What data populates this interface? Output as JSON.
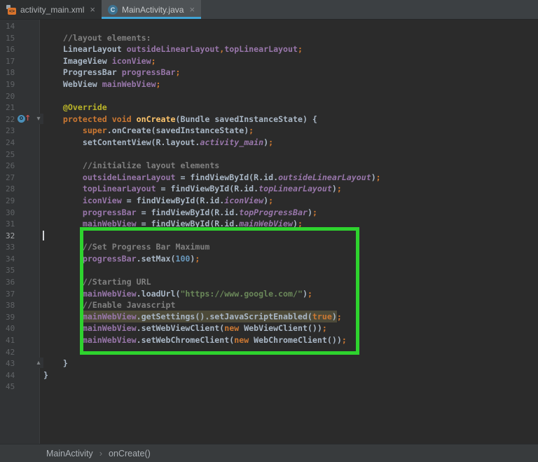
{
  "tabs": [
    {
      "label": "activity_main.xml",
      "icon": "android-layout-xml-icon",
      "active": false
    },
    {
      "label": "MainActivity.java",
      "icon": "java-class-icon",
      "active": true
    }
  ],
  "icons": {
    "close_glyph": "×",
    "xml_icon_glyph": "<>",
    "class_icon_letter": "C",
    "fold_open_glyph": "▾",
    "fold_close_glyph": "▴",
    "override_letter": "o",
    "override_arrow": "↑",
    "breadcrumb_separator": "›"
  },
  "colors": {
    "editor_bg": "#2B2B2B",
    "gutter_bg": "#313335",
    "tab_active_underline": "#40A3D5",
    "annotation_box_green": "#2ED32E",
    "usage_highlight": "#4D4A39",
    "keyword_orange": "#CC7832",
    "field_purple": "#9876AA",
    "string_green": "#6A8759",
    "comment_gray": "#808080"
  },
  "breadcrumb": {
    "items": [
      "MainActivity",
      "onCreate()"
    ]
  },
  "editor": {
    "current_line": 32,
    "lines": [
      {
        "n": 14,
        "t": []
      },
      {
        "n": 15,
        "t": [
          [
            "    ",
            "p"
          ],
          [
            "//layout elements:",
            "c"
          ]
        ]
      },
      {
        "n": 16,
        "t": [
          [
            "    LinearLayout ",
            "p"
          ],
          [
            "outsideLinearLayout",
            "f"
          ],
          [
            ",",
            "k"
          ],
          [
            "topLinearLayout",
            "f"
          ],
          [
            ";",
            "k"
          ]
        ]
      },
      {
        "n": 17,
        "t": [
          [
            "    ImageView ",
            "p"
          ],
          [
            "iconView",
            "f"
          ],
          [
            ";",
            "k"
          ]
        ]
      },
      {
        "n": 18,
        "t": [
          [
            "    ProgressBar ",
            "p"
          ],
          [
            "progressBar",
            "f"
          ],
          [
            ";",
            "k"
          ]
        ]
      },
      {
        "n": 19,
        "t": [
          [
            "    WebView ",
            "p"
          ],
          [
            "mainWebView",
            "f"
          ],
          [
            ";",
            "k"
          ]
        ]
      },
      {
        "n": 20,
        "t": []
      },
      {
        "n": 21,
        "t": [
          [
            "    ",
            "p"
          ],
          [
            "@Override",
            "a"
          ]
        ]
      },
      {
        "n": 22,
        "marker": "override",
        "t": [
          [
            "    ",
            "p"
          ],
          [
            "protected",
            "k"
          ],
          [
            " ",
            "p"
          ],
          [
            "void",
            "k"
          ],
          [
            " ",
            "p"
          ],
          [
            "onCreate",
            "m"
          ],
          [
            "(Bundle savedInstanceState) {",
            "p"
          ]
        ]
      },
      {
        "n": 23,
        "t": [
          [
            "        ",
            "p"
          ],
          [
            "super",
            "k"
          ],
          [
            ".onCreate(savedInstanceState)",
            "p"
          ],
          [
            ";",
            "k"
          ]
        ]
      },
      {
        "n": 24,
        "t": [
          [
            "        setContentView(R.layout.",
            "p"
          ],
          [
            "activity_main",
            "fi"
          ],
          [
            ")",
            "p"
          ],
          [
            ";",
            "k"
          ]
        ]
      },
      {
        "n": 25,
        "t": []
      },
      {
        "n": 26,
        "t": [
          [
            "        ",
            "p"
          ],
          [
            "//initialize layout elements",
            "c"
          ]
        ]
      },
      {
        "n": 27,
        "t": [
          [
            "        ",
            "p"
          ],
          [
            "outsideLinearLayout",
            "f"
          ],
          [
            " = findViewById(R.id.",
            "p"
          ],
          [
            "outsideLinearLayout",
            "fi"
          ],
          [
            ")",
            "p"
          ],
          [
            ";",
            "k"
          ]
        ]
      },
      {
        "n": 28,
        "t": [
          [
            "        ",
            "p"
          ],
          [
            "topLinearLayout",
            "f"
          ],
          [
            " = findViewById(R.id.",
            "p"
          ],
          [
            "topLinearLayout",
            "fi"
          ],
          [
            ")",
            "p"
          ],
          [
            ";",
            "k"
          ]
        ]
      },
      {
        "n": 29,
        "t": [
          [
            "        ",
            "p"
          ],
          [
            "iconView",
            "f"
          ],
          [
            " = findViewById(R.id.",
            "p"
          ],
          [
            "iconView",
            "fi"
          ],
          [
            ")",
            "p"
          ],
          [
            ";",
            "k"
          ]
        ]
      },
      {
        "n": 30,
        "t": [
          [
            "        ",
            "p"
          ],
          [
            "progressBar",
            "f"
          ],
          [
            " = findViewById(R.id.",
            "p"
          ],
          [
            "topProgressBar",
            "fi"
          ],
          [
            ")",
            "p"
          ],
          [
            ";",
            "k"
          ]
        ]
      },
      {
        "n": 31,
        "t": [
          [
            "        ",
            "p"
          ],
          [
            "mainWebView",
            "f"
          ],
          [
            " = findViewById(R.id.",
            "p"
          ],
          [
            "mainWebView",
            "fi"
          ],
          [
            ")",
            "p"
          ],
          [
            ";",
            "k"
          ]
        ]
      },
      {
        "n": 32,
        "caret": true,
        "t": []
      },
      {
        "n": 33,
        "t": [
          [
            "        ",
            "p"
          ],
          [
            "//Set Progress Bar Maximum",
            "c"
          ]
        ]
      },
      {
        "n": 34,
        "t": [
          [
            "        ",
            "p"
          ],
          [
            "progressBar",
            "f"
          ],
          [
            ".setMax(",
            "p"
          ],
          [
            "100",
            "n"
          ],
          [
            ")",
            "p"
          ],
          [
            ";",
            "k"
          ]
        ]
      },
      {
        "n": 35,
        "t": []
      },
      {
        "n": 36,
        "t": [
          [
            "        ",
            "p"
          ],
          [
            "//Starting URL",
            "c"
          ]
        ]
      },
      {
        "n": 37,
        "t": [
          [
            "        ",
            "p"
          ],
          [
            "mainWebView",
            "f"
          ],
          [
            ".loadUrl(",
            "p"
          ],
          [
            "\"https://www.google.com/\"",
            "s"
          ],
          [
            ")",
            "p"
          ],
          [
            ";",
            "k"
          ]
        ]
      },
      {
        "n": 38,
        "t": [
          [
            "        ",
            "p"
          ],
          [
            "//Enable Javascript",
            "c"
          ]
        ]
      },
      {
        "n": 39,
        "t": [
          [
            "        ",
            "p"
          ],
          [
            "mainWebView",
            "f",
            1
          ],
          [
            ".getSettings().setJavaScriptEnabled(",
            "p",
            1
          ],
          [
            "true",
            "k",
            1
          ],
          [
            ")",
            "p",
            1
          ],
          [
            ";",
            "k"
          ]
        ]
      },
      {
        "n": 40,
        "t": [
          [
            "        ",
            "p"
          ],
          [
            "mainWebView",
            "f"
          ],
          [
            ".setWebViewClient(",
            "p"
          ],
          [
            "new",
            "k"
          ],
          [
            " WebViewClient())",
            "p"
          ],
          [
            ";",
            "k"
          ]
        ]
      },
      {
        "n": 41,
        "t": [
          [
            "        ",
            "p"
          ],
          [
            "mainWebView",
            "f"
          ],
          [
            ".setWebChromeClient(",
            "p"
          ],
          [
            "new",
            "k"
          ],
          [
            " WebChromeClient())",
            "p"
          ],
          [
            ";",
            "k"
          ]
        ]
      },
      {
        "n": 42,
        "t": []
      },
      {
        "n": 43,
        "marker": "fold-end",
        "t": [
          [
            "    }",
            "p"
          ]
        ]
      },
      {
        "n": 44,
        "t": [
          [
            "}",
            "p"
          ]
        ]
      },
      {
        "n": 45,
        "t": []
      }
    ]
  }
}
